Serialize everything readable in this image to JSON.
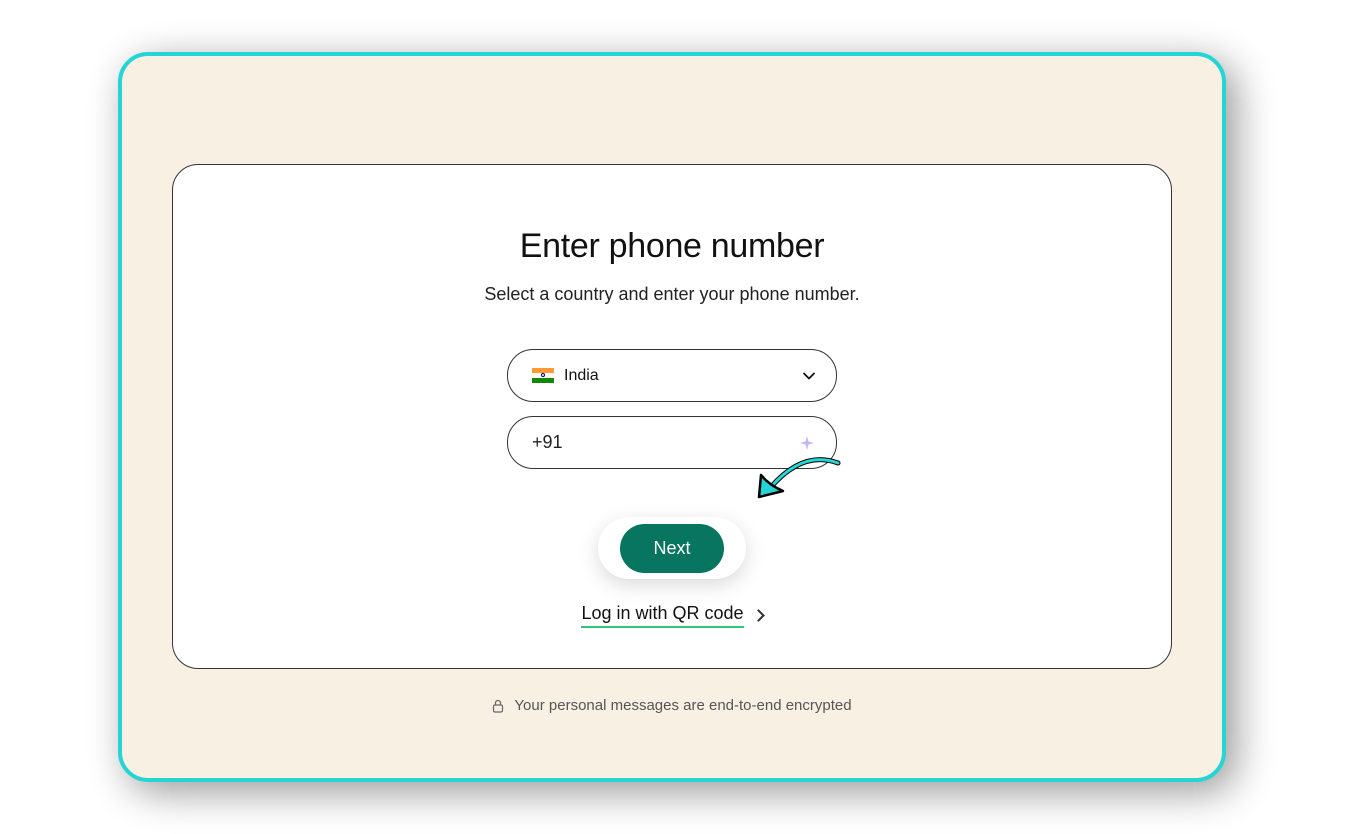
{
  "header": {
    "title": "Enter phone number",
    "subtitle": "Select a country and enter your phone number."
  },
  "country": {
    "name": "India",
    "flag_icon": "india-flag"
  },
  "phone": {
    "value": "+91"
  },
  "actions": {
    "next_label": "Next",
    "qr_link_label": "Log in with QR code"
  },
  "footer": {
    "encryption_text": "Your personal messages are end-to-end encrypted"
  }
}
